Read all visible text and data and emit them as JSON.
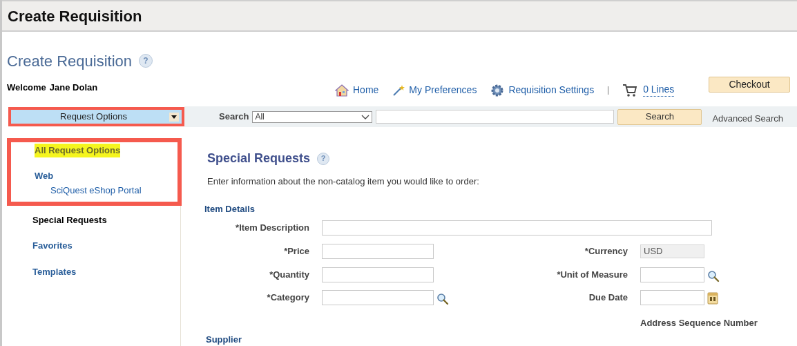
{
  "header": {
    "title": "Create Requisition"
  },
  "page_title": "Create Requisition",
  "page_help": "?",
  "welcome": {
    "label": "Welcome",
    "name": "Jane Dolan"
  },
  "nav_links": [
    {
      "kind": "home",
      "label": "Home"
    },
    {
      "kind": "wand",
      "label": "My Preferences"
    },
    {
      "kind": "gear",
      "label": "Requisition Settings"
    }
  ],
  "cart": {
    "label": "0 Lines"
  },
  "checkout_button": "Checkout",
  "request_options": {
    "label": "Request Options",
    "highlighted": true
  },
  "search": {
    "label": "Search",
    "scope": "All",
    "button": "Search",
    "advanced": "Advanced Search"
  },
  "sidebar": {
    "groups": [
      {
        "highlighted": true,
        "items": [
          {
            "label": "All Request Options",
            "selected": false,
            "marked": true
          },
          {
            "label": "Web",
            "selected": false,
            "marked": false,
            "children": [
              {
                "label": "SciQuest eShop Portal",
                "selected": false,
                "marked": false
              }
            ]
          }
        ]
      },
      {
        "highlighted": false,
        "items": [
          {
            "label": "Special Requests",
            "selected": true,
            "marked": false
          },
          {
            "label": "Favorites",
            "selected": false,
            "marked": false
          },
          {
            "label": "Templates",
            "selected": false,
            "marked": false
          }
        ]
      }
    ]
  },
  "section": {
    "title": "Special Requests",
    "help": "?",
    "intro": "Enter information about the non-catalog item you would like to order:"
  },
  "item_details": {
    "title": "Item Details",
    "rows": [
      {
        "left": {
          "label": "*Item Description",
          "kind": "wide"
        }
      },
      {
        "left": {
          "label": "*Price",
          "kind": "text"
        },
        "right": {
          "label": "*Currency",
          "kind": "readonly",
          "value": "USD"
        }
      },
      {
        "left": {
          "label": "*Quantity",
          "kind": "text"
        },
        "right": {
          "label": "*Unit of Measure",
          "kind": "lookup"
        }
      },
      {
        "left": {
          "label": "*Category",
          "kind": "lookup"
        },
        "right": {
          "label": "Due Date",
          "kind": "date"
        }
      },
      {
        "right": {
          "label": "Address Sequence Number",
          "kind": "heading"
        }
      }
    ]
  },
  "supplier": {
    "title": "Supplier"
  }
}
